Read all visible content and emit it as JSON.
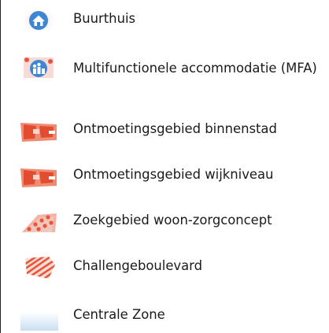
{
  "legend": {
    "items": [
      {
        "label": "Buurthuis",
        "icon": "house-icon",
        "color": "#3d86d4"
      },
      {
        "label": "Multifunctionele accommodatie (MFA)",
        "icon": "multi-person-icon",
        "color": "#3d86d4"
      },
      {
        "label": "Ontmoetingsgebied binnenstad",
        "icon": "meeting-area-city-icon",
        "color": "#e8553a"
      },
      {
        "label": "Ontmoetingsgebied wijkniveau",
        "icon": "meeting-area-district-icon",
        "color": "#e8553a"
      },
      {
        "label": "Zoekgebied woon-zorgconcept",
        "icon": "search-area-dots-icon",
        "color": "#e8553a"
      },
      {
        "label": "Challengeboulevard",
        "icon": "striped-boulevard-icon",
        "color": "#e8553a"
      },
      {
        "label": "Centrale Zone",
        "icon": "central-zone-icon",
        "color": "#cfe3f4"
      }
    ]
  }
}
